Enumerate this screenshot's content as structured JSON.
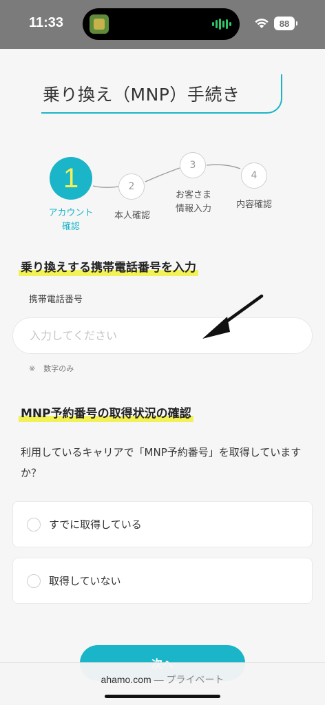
{
  "status_bar": {
    "time": "11:33",
    "battery": "88",
    "icons": [
      "app-thumbnail-icon",
      "audio-waveform-icon",
      "wifi-icon",
      "battery-icon"
    ]
  },
  "page": {
    "title": "乗り換え（MNP）手続き"
  },
  "steps": [
    {
      "number": "1",
      "label": "アカウント\n確認",
      "active": true
    },
    {
      "number": "2",
      "label": "本人確認",
      "active": false
    },
    {
      "number": "3",
      "label": "お客さま\n情報入力",
      "active": false
    },
    {
      "number": "4",
      "label": "内容確認",
      "active": false
    }
  ],
  "phone_section": {
    "heading": "乗り換えする携帯電話番号を入力",
    "field_label": "携帯電話番号",
    "placeholder": "入力してください",
    "value": "",
    "note_mark": "※",
    "note_text": "数字のみ"
  },
  "mnp_section": {
    "heading": "MNP予約番号の取得状況の確認",
    "question": "利用しているキャリアで「MNP予約番号」を取得していますか？",
    "options": [
      {
        "label": "すでに取得している",
        "selected": false
      },
      {
        "label": "取得していない",
        "selected": false
      }
    ]
  },
  "next_button": {
    "label": "次へ"
  },
  "browser": {
    "domain": "ahamo.com",
    "separator": "—",
    "mode": "プライベート"
  },
  "colors": {
    "accent": "#1ab5c8",
    "highlight": "#f3f158",
    "status_bar": "#7b7b7b",
    "background": "#f6f6f6"
  }
}
